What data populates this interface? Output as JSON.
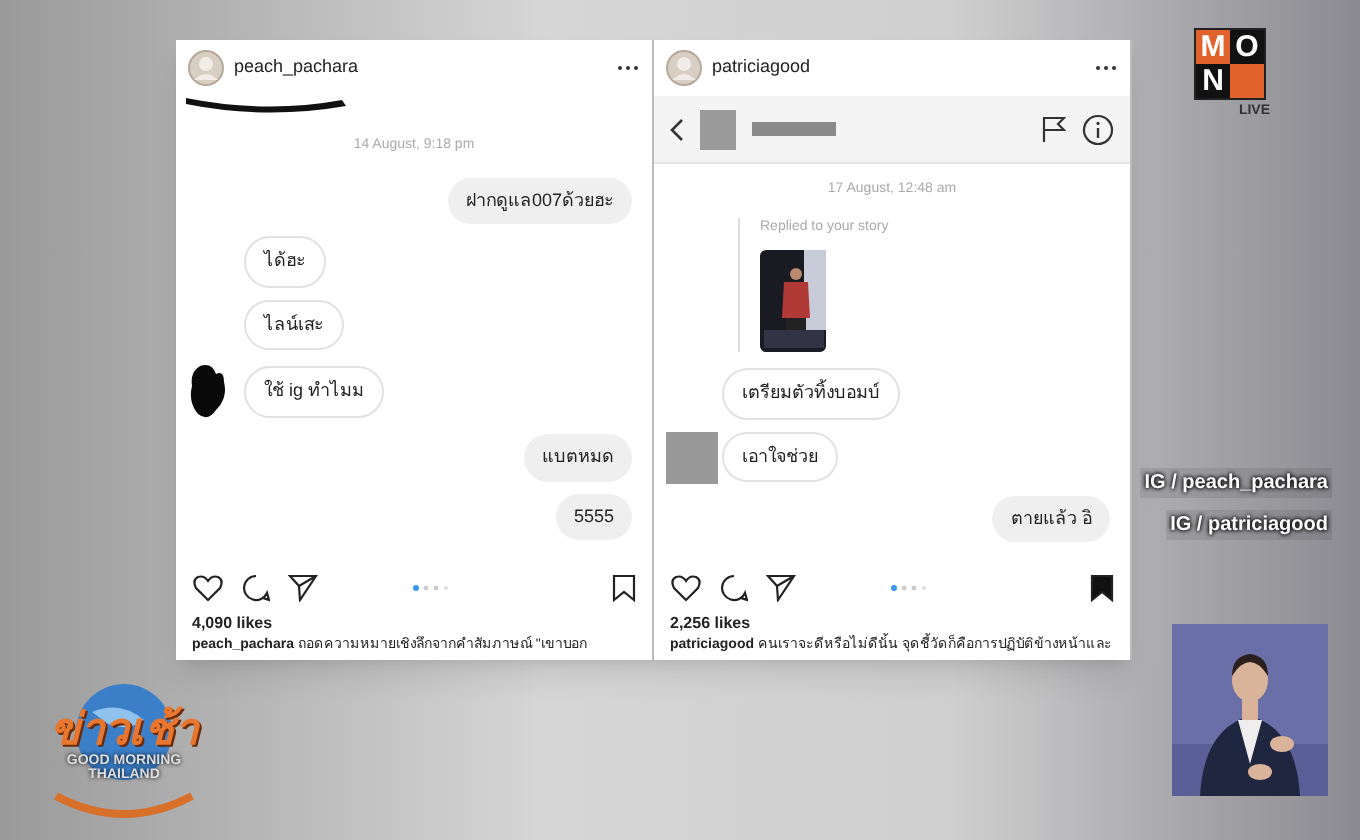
{
  "posts": [
    {
      "username": "peach_pachara",
      "saved": false,
      "has_nav": false,
      "date": "14 August, 9:18 pm",
      "messages": [
        {
          "kind": "text",
          "outgoing": true,
          "text": "ฝากดูแล007ด้วยฮะ"
        },
        {
          "kind": "text",
          "outgoing": false,
          "text": "ได้ฮะ"
        },
        {
          "kind": "text",
          "outgoing": false,
          "text": "ไลน์เสะ"
        },
        {
          "kind": "text",
          "outgoing": false,
          "text": "ใช้ ig ทำไมม"
        },
        {
          "kind": "text",
          "outgoing": true,
          "text": "แบตหมด"
        },
        {
          "kind": "text",
          "outgoing": true,
          "text": "5555"
        }
      ],
      "likes": "4,090 likes",
      "caption_user": "peach_pachara",
      "caption": "ถอดความหมายเชิงลึกจากคำสัมภาษณ์ \"เขาบอก"
    },
    {
      "username": "patriciagood",
      "saved": true,
      "has_nav": true,
      "date": "17 August, 12:48 am",
      "messages": [
        {
          "kind": "story_reply",
          "outgoing": false,
          "text": "Replied to your story"
        },
        {
          "kind": "text",
          "outgoing": false,
          "text": "เตรียมตัวทิ้งบอมบ์"
        },
        {
          "kind": "text",
          "outgoing": false,
          "text": "เอาใจช่วย"
        },
        {
          "kind": "text",
          "outgoing": true,
          "text": "ตายแล้ว อิ"
        }
      ],
      "likes": "2,256 likes",
      "caption_user": "patriciagood",
      "caption": "คนเราจะดีหรือไม่ดีนั้น จุดชี้วัดก็คือการปฏิบัติข้างหน้าและ"
    }
  ],
  "credits": [
    {
      "prefix": "IG",
      "text": "/ peach_pachara"
    },
    {
      "prefix": "IG",
      "text": "/ patriciagood"
    }
  ],
  "channel_logo": {
    "letters": [
      "M",
      "O",
      "N"
    ],
    "badge": "LIVE"
  },
  "show_logo": {
    "title": "ข่าวเช้า",
    "line_1": "GOOD MORNING",
    "line_2": "THAILAND"
  }
}
